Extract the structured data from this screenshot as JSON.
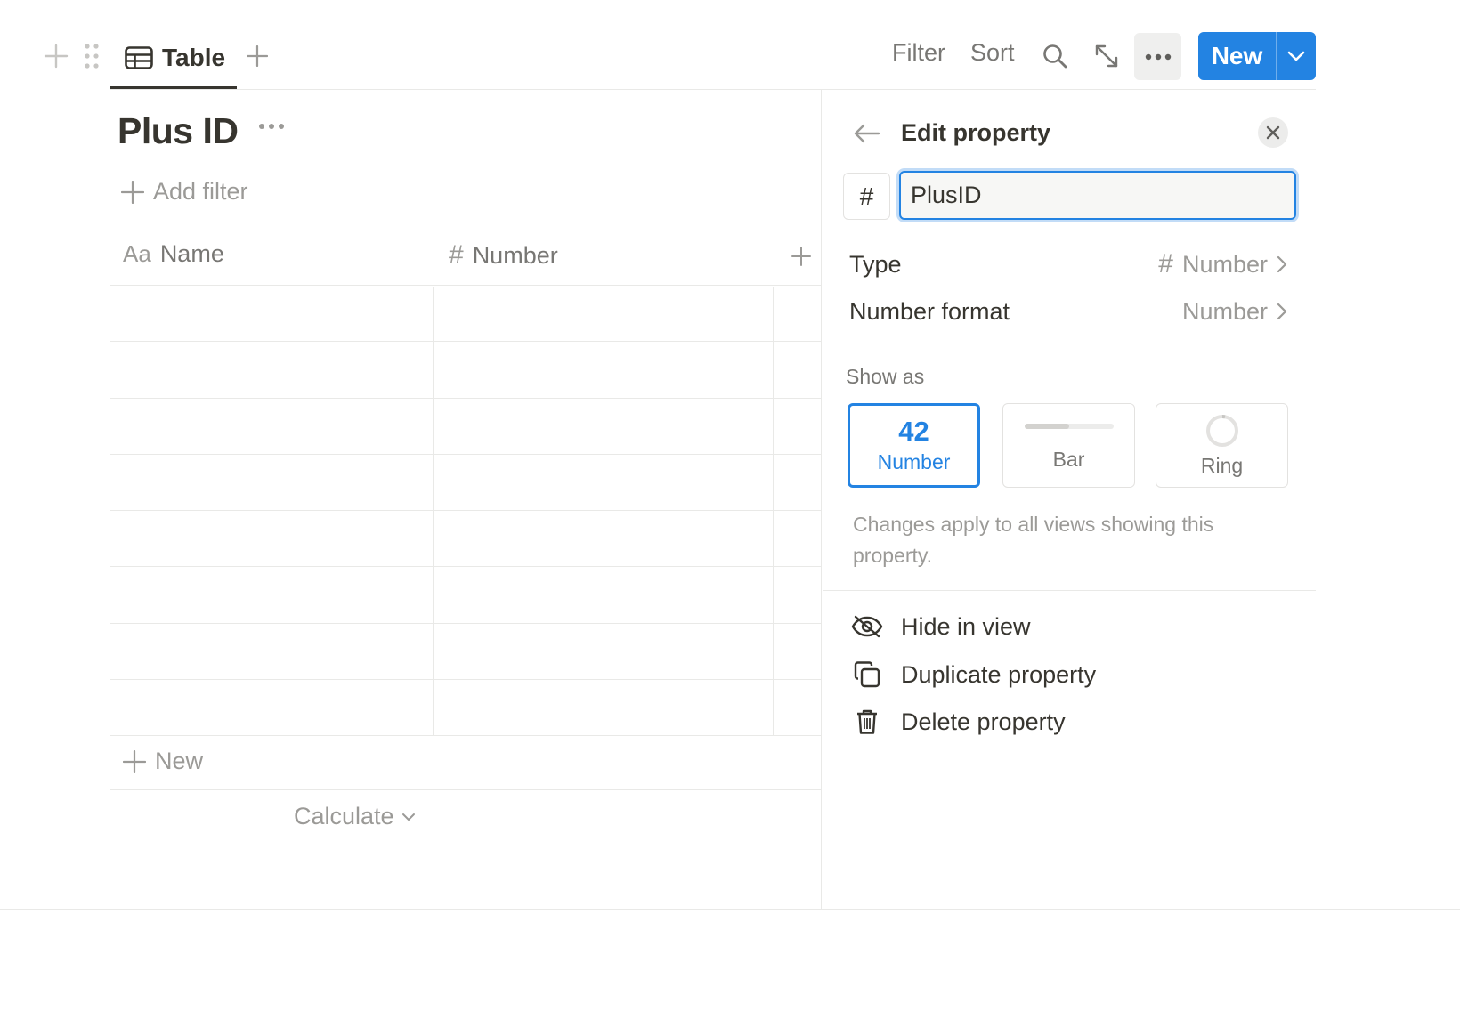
{
  "toolbar": {
    "view_tab_label": "Table",
    "filter_label": "Filter",
    "sort_label": "Sort",
    "new_label": "New"
  },
  "database": {
    "title": "Plus ID",
    "add_filter_label": "Add filter",
    "columns": [
      {
        "icon_text": "Aa",
        "label": "Name"
      },
      {
        "icon_text": "#",
        "label": "Number"
      }
    ],
    "row_count": 8,
    "new_row_label": "New",
    "calculate_label": "Calculate"
  },
  "panel": {
    "title": "Edit property",
    "type_glyph": "#",
    "name_value": "PlusID",
    "type_key": "Type",
    "type_value": "Number",
    "format_key": "Number format",
    "format_value": "Number",
    "show_as_label": "Show as",
    "show_options": [
      {
        "display": "42",
        "label": "Number",
        "selected": true
      },
      {
        "label": "Bar",
        "selected": false
      },
      {
        "label": "Ring",
        "selected": false
      }
    ],
    "note": "Changes apply to all views showing this property.",
    "actions": [
      {
        "icon": "eye-off-icon",
        "label": "Hide in view"
      },
      {
        "icon": "duplicate-icon",
        "label": "Duplicate property"
      },
      {
        "icon": "trash-icon",
        "label": "Delete property"
      }
    ]
  },
  "colors": {
    "accent": "#2383e2",
    "text": "#37352f",
    "muted": "#9b9a97"
  }
}
